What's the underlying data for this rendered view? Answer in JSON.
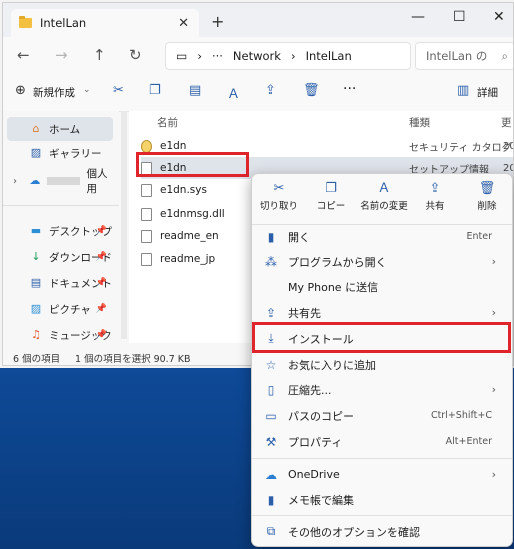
{
  "window": {
    "tab_title": "IntelLan",
    "tab_close": "✕",
    "new_tab": "+",
    "minimize": "—",
    "maximize": "☐",
    "close": "✕"
  },
  "address": {
    "more": "···",
    "sep1": "›",
    "sep2": "›",
    "crumb_network": "Network",
    "crumb_current": "IntelLan",
    "search_text": "IntelLan の"
  },
  "toolbar": {
    "new_label": "新規作成",
    "more": "···",
    "details_label": "詳細"
  },
  "sidebar": {
    "items": [
      {
        "label": "ホーム",
        "icon": "home-icon"
      },
      {
        "label": "ギャラリー",
        "icon": "gallery-icon"
      },
      {
        "label": "個人用",
        "icon": "onedrive-icon"
      },
      {
        "label": "デスクトップ",
        "icon": "desktop-icon"
      },
      {
        "label": "ダウンロード",
        "icon": "download-icon"
      },
      {
        "label": "ドキュメント",
        "icon": "document-icon"
      },
      {
        "label": "ピクチャ",
        "icon": "picture-icon"
      },
      {
        "label": "ミュージック",
        "icon": "music-icon"
      }
    ]
  },
  "columns": {
    "name": "名前",
    "type": "種類",
    "modified": "更"
  },
  "files": [
    {
      "name": "e1dn",
      "type": "セキュリティ カタログ",
      "mod": "20"
    },
    {
      "name": "e1dn",
      "type": "セットアップ情報",
      "mod": "20"
    },
    {
      "name": "e1dn.sys",
      "type": "",
      "mod": ""
    },
    {
      "name": "e1dnmsg.dll",
      "type": "",
      "mod": ""
    },
    {
      "name": "readme_en",
      "type": "",
      "mod": ""
    },
    {
      "name": "readme_jp",
      "type": "",
      "mod": ""
    }
  ],
  "status": {
    "count": "6 個の項目",
    "selected": "1 個の項目を選択 90.7 KB"
  },
  "menu": {
    "quick": [
      {
        "label": "切り取り",
        "icon": "cut-icon"
      },
      {
        "label": "コピー",
        "icon": "copy-icon"
      },
      {
        "label": "名前の変更",
        "icon": "rename-icon"
      },
      {
        "label": "共有",
        "icon": "share-icon"
      },
      {
        "label": "削除",
        "icon": "delete-icon"
      }
    ],
    "items": [
      {
        "label": "開く",
        "accel": "Enter"
      },
      {
        "label": "プログラムから開く",
        "arrow": "›"
      },
      {
        "label": "My Phone に送信"
      },
      {
        "label": "共有先",
        "arrow": "›"
      },
      {
        "label": "インストール"
      },
      {
        "label": "お気に入りに追加"
      },
      {
        "label": "圧縮先...",
        "arrow": "›"
      },
      {
        "label": "パスのコピー",
        "accel": "Ctrl+Shift+C"
      },
      {
        "label": "プロパティ",
        "accel": "Alt+Enter"
      },
      {
        "label": "OneDrive",
        "arrow": "›"
      },
      {
        "label": "メモ帳で編集"
      },
      {
        "label": "その他のオプションを確認"
      }
    ]
  },
  "colors": {
    "highlight": "#e0242c",
    "accent": "#2b5faa"
  }
}
